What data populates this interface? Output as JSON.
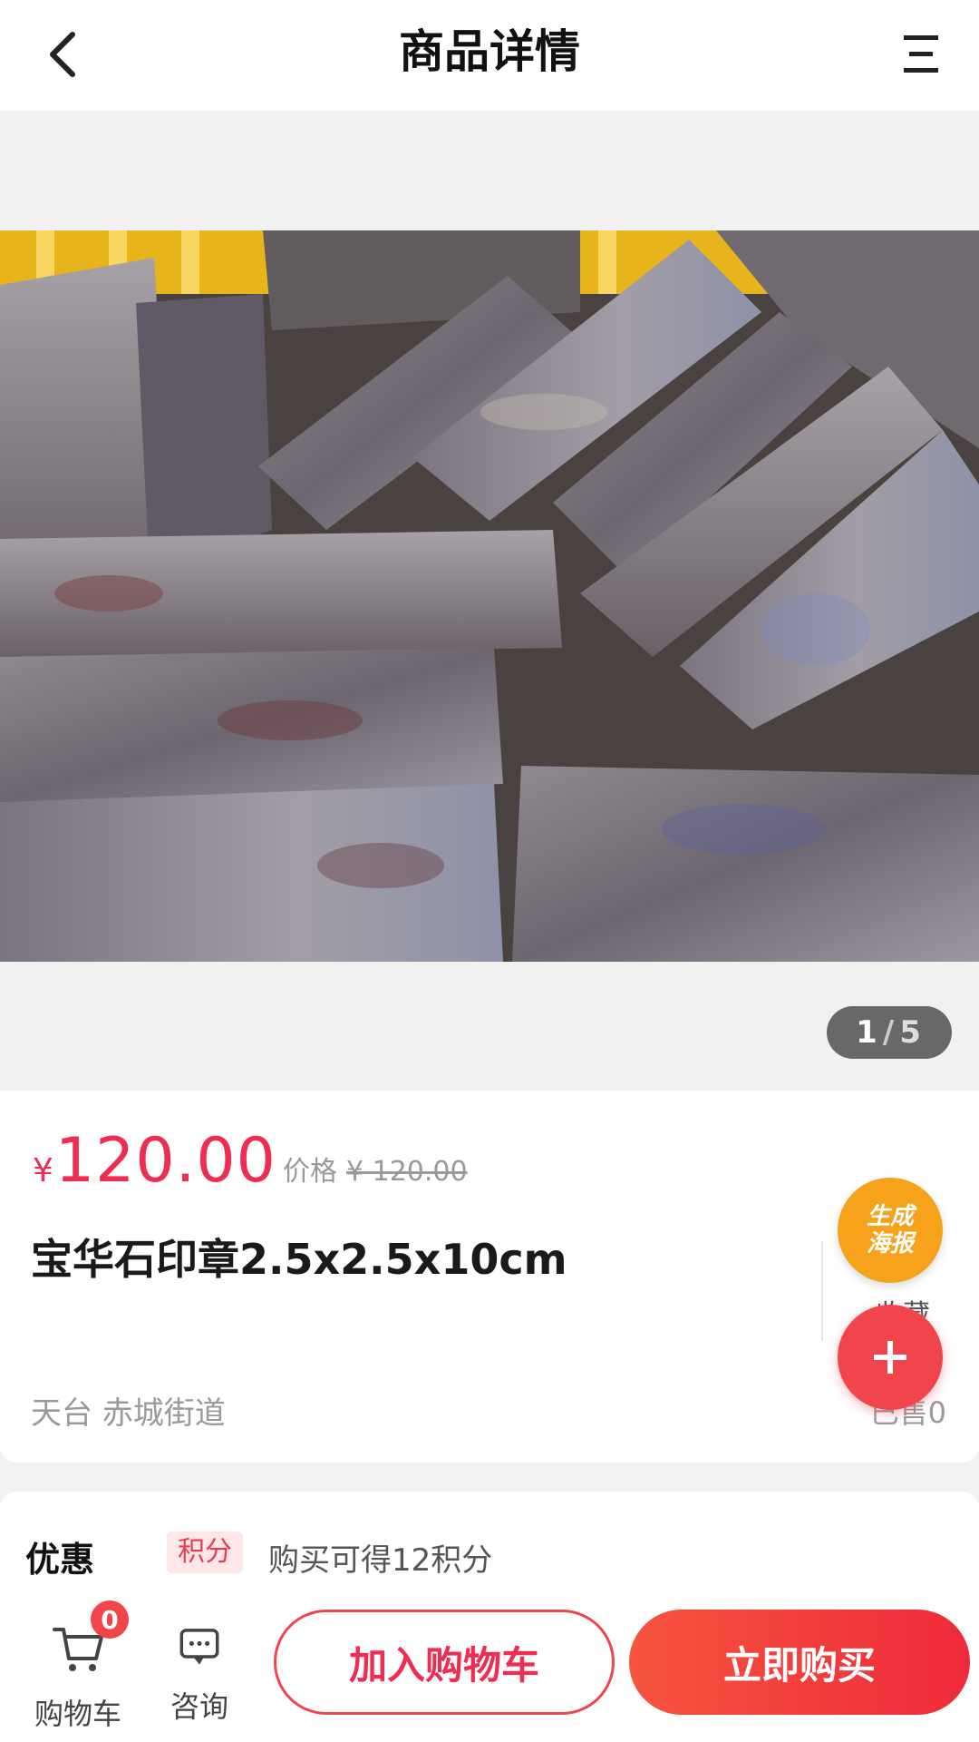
{
  "header": {
    "title": "商品详情",
    "back_icon": "chevron-left-icon",
    "menu_icon": "menu-icon"
  },
  "gallery": {
    "current": "1",
    "separator": "/",
    "total": "5"
  },
  "product": {
    "currency": "¥",
    "price": "120.00",
    "orig_price_label": "价格",
    "orig_price": "¥ 120.00",
    "name": "宝华石印章2.5x2.5x10cm",
    "location": "天台 赤城街道",
    "favorite_label": "收藏",
    "sold": "已售0"
  },
  "floating": {
    "poster_line1": "生成",
    "poster_line2": "海报",
    "add_icon": "plus-icon"
  },
  "promo": {
    "title": "优惠",
    "tag": "积分",
    "text": "购买可得12积分"
  },
  "bottom": {
    "cart_label": "购物车",
    "cart_count": "0",
    "consult_label": "咨询",
    "add_to_cart": "加入购物车",
    "buy_now": "立即购买"
  },
  "colors": {
    "accent": "#ee2d52",
    "poster": "#f6a21a",
    "fab": "#f0454d"
  }
}
